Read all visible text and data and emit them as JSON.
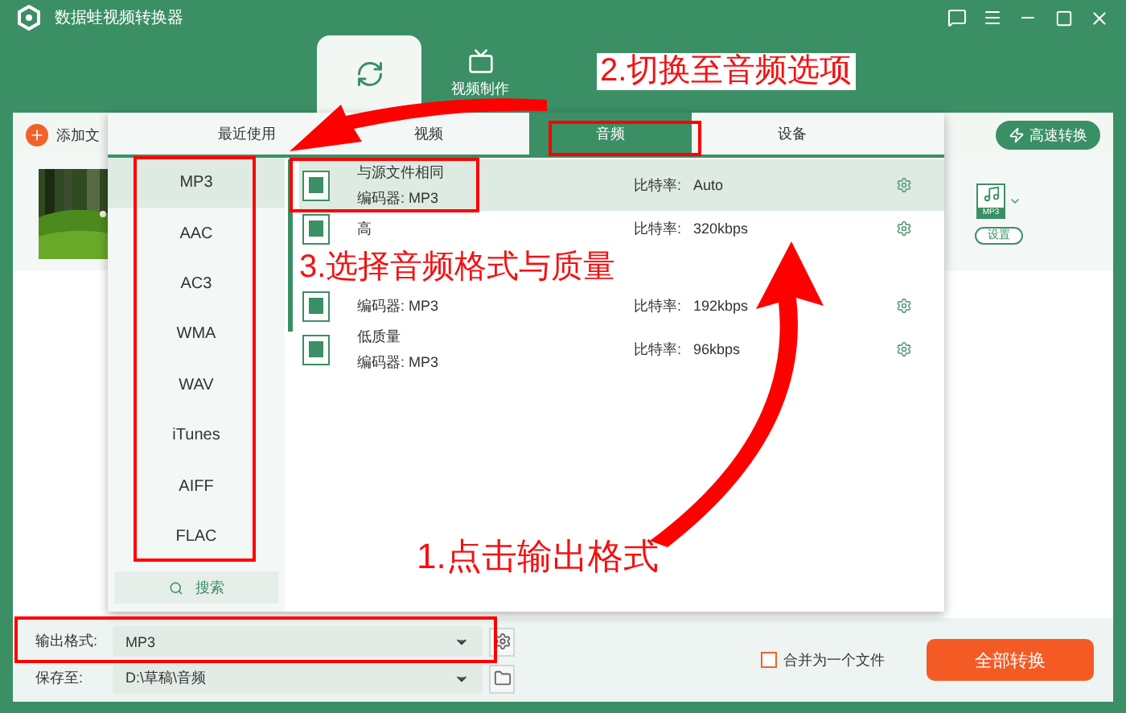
{
  "window": {
    "title": "数据蛙视频转换器"
  },
  "nav_tabs": [
    {
      "selected": true
    },
    {
      "label": "视频制作",
      "selected": false
    }
  ],
  "toolbar": {
    "add_file": "添加文",
    "fast_convert": "高速转换"
  },
  "file_item": {
    "kind": "picture",
    "format_badge": "MP3",
    "settings": "设置"
  },
  "popup": {
    "tabs": [
      {
        "label": "最近使用",
        "selected": false
      },
      {
        "label": "视频",
        "selected": false
      },
      {
        "label": "音频",
        "selected": true
      },
      {
        "label": "设备",
        "selected": false
      }
    ],
    "formats": [
      {
        "label": "MP3",
        "selected": true
      },
      {
        "label": "AAC",
        "selected": false
      },
      {
        "label": "AC3",
        "selected": false
      },
      {
        "label": "WMA",
        "selected": false
      },
      {
        "label": "WAV",
        "selected": false
      },
      {
        "label": "iTunes",
        "selected": false
      },
      {
        "label": "AIFF",
        "selected": false
      },
      {
        "label": "FLAC",
        "selected": false
      }
    ],
    "search": "搜索",
    "presets": [
      {
        "name": "与源文件相同",
        "encoder_label": "编码器:",
        "encoder": "MP3",
        "bitrate_label": "比特率:",
        "bitrate": "Auto",
        "selected": true
      },
      {
        "name": "高",
        "bitrate_label": "比特率:",
        "bitrate": "320kbps",
        "selected": false
      },
      {
        "encoder_label": "编码器:",
        "encoder": "MP3",
        "bitrate_label": "比特率:",
        "bitrate": "192kbps",
        "selected": false
      },
      {
        "name": "低质量",
        "encoder_label": "编码器:",
        "encoder": "MP3",
        "bitrate_label": "比特率:",
        "bitrate": "96kbps",
        "selected": false
      }
    ]
  },
  "bottom_bar": {
    "output_label": "输出格式:",
    "output_value": "MP3",
    "save_label": "保存至:",
    "save_value": "D:\\草稿\\音频",
    "merge": {
      "label": "合并为一个文件",
      "checked": false
    },
    "convert": "全部转换"
  },
  "annotations": [
    {
      "text": "2.切换至音频选项"
    },
    {
      "text": "3.选择音频格式与质量"
    },
    {
      "text": "1.点击输出格式"
    }
  ]
}
